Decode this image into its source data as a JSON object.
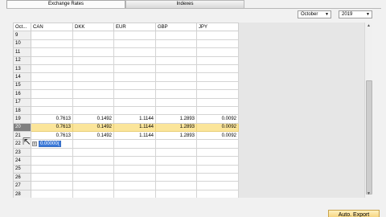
{
  "tabs": [
    {
      "label": "Exchange Rates",
      "active": true
    },
    {
      "label": "Indexes",
      "active": false
    }
  ],
  "filters": {
    "month": "October",
    "year": "2019"
  },
  "grid": {
    "columns": [
      "Oct...",
      "CAN",
      "DKK",
      "EUR",
      "GBP",
      "JPY"
    ],
    "rows": [
      {
        "day": "9",
        "values": [
          "",
          "",
          "",
          "",
          ""
        ]
      },
      {
        "day": "10",
        "values": [
          "",
          "",
          "",
          "",
          ""
        ]
      },
      {
        "day": "11",
        "values": [
          "",
          "",
          "",
          "",
          ""
        ]
      },
      {
        "day": "12",
        "values": [
          "",
          "",
          "",
          "",
          ""
        ]
      },
      {
        "day": "13",
        "values": [
          "",
          "",
          "",
          "",
          ""
        ]
      },
      {
        "day": "14",
        "values": [
          "",
          "",
          "",
          "",
          ""
        ]
      },
      {
        "day": "15",
        "values": [
          "",
          "",
          "",
          "",
          ""
        ]
      },
      {
        "day": "16",
        "values": [
          "",
          "",
          "",
          "",
          ""
        ]
      },
      {
        "day": "17",
        "values": [
          "",
          "",
          "",
          "",
          ""
        ]
      },
      {
        "day": "18",
        "values": [
          "",
          "",
          "",
          "",
          ""
        ]
      },
      {
        "day": "19",
        "values": [
          "0.7613",
          "0.1492",
          "1.1144",
          "1.2893",
          "0.0092"
        ]
      },
      {
        "day": "20",
        "values": [
          "0.7613",
          "0.1492",
          "1.1144",
          "1.2893",
          "0.0092"
        ],
        "selected": true
      },
      {
        "day": "21",
        "values": [
          "0.7613",
          "0.1492",
          "1.1144",
          "1.2893",
          "0.0092"
        ]
      },
      {
        "day": "22",
        "values": [
          "",
          "",
          "",
          "",
          ""
        ],
        "editing_value": "0.00000("
      },
      {
        "day": "23",
        "values": [
          "",
          "",
          "",
          "",
          ""
        ]
      },
      {
        "day": "24",
        "values": [
          "",
          "",
          "",
          "",
          ""
        ]
      },
      {
        "day": "25",
        "values": [
          "",
          "",
          "",
          "",
          ""
        ]
      },
      {
        "day": "26",
        "values": [
          "",
          "",
          "",
          "",
          ""
        ]
      },
      {
        "day": "27",
        "values": [
          "",
          "",
          "",
          "",
          ""
        ]
      },
      {
        "day": "28",
        "values": [
          "",
          "",
          "",
          "",
          ""
        ]
      }
    ]
  },
  "buttons": {
    "auto_export": "Auto. Export"
  },
  "colors": {
    "selected_row": "#fbe59a",
    "accent": "#3a78d8",
    "button": "#f3c864"
  },
  "icons": {
    "dropdown": "chevron-down-icon",
    "expand": "expand-arrow-icon",
    "cursor": "mouse-cursor-icon"
  }
}
